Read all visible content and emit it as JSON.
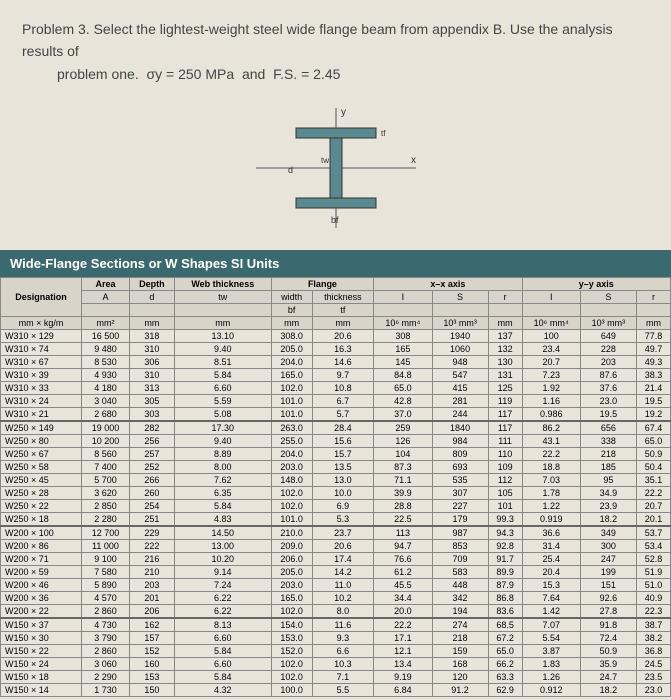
{
  "problem": {
    "title": "Problem 3.",
    "text1": "Select the lightest-weight steel wide flange beam from appendix B. Use the analysis results of",
    "text2": "problem one.",
    "sigma": "σy = 250 MPa",
    "and": "and",
    "fs": "F.S. = 2.45"
  },
  "diagram": {
    "y": "y",
    "x": "x",
    "tw": "tw",
    "d": "d",
    "tf": "tf",
    "bf": "bf"
  },
  "table_title": "Wide-Flange Sections or W Shapes   SI Units",
  "headers": {
    "flange": "Flange",
    "xx": "x–x axis",
    "yy": "y–y axis",
    "designation": "Designation",
    "area": "Area",
    "depth": "Depth",
    "web_thick": "Web thickness",
    "width": "width",
    "thickness": "thickness",
    "A": "A",
    "d": "d",
    "tw": "tw",
    "bf": "bf",
    "tf": "tf",
    "I": "I",
    "S": "S",
    "r": "r",
    "u_desig": "mm × kg/m",
    "u_mm2": "mm²",
    "u_mm": "mm",
    "u_I": "10⁶ mm⁴",
    "u_S": "10³ mm³",
    "u_r": "mm"
  },
  "rows": [
    {
      "d": "W310 × 129",
      "A": "16 500",
      "dep": "318",
      "tw": "13.10",
      "bf": "308.0",
      "tf": "20.6",
      "Ix": "308",
      "Sx": "1940",
      "rx": "137",
      "Iy": "100",
      "Sy": "649",
      "ry": "77.8"
    },
    {
      "d": "W310 × 74",
      "A": "9 480",
      "dep": "310",
      "tw": "9.40",
      "bf": "205.0",
      "tf": "16.3",
      "Ix": "165",
      "Sx": "1060",
      "rx": "132",
      "Iy": "23.4",
      "Sy": "228",
      "ry": "49.7"
    },
    {
      "d": "W310 × 67",
      "A": "8 530",
      "dep": "306",
      "tw": "8.51",
      "bf": "204.0",
      "tf": "14.6",
      "Ix": "145",
      "Sx": "948",
      "rx": "130",
      "Iy": "20.7",
      "Sy": "203",
      "ry": "49.3"
    },
    {
      "d": "W310 × 39",
      "A": "4 930",
      "dep": "310",
      "tw": "5.84",
      "bf": "165.0",
      "tf": "9.7",
      "Ix": "84.8",
      "Sx": "547",
      "rx": "131",
      "Iy": "7.23",
      "Sy": "87.6",
      "ry": "38.3"
    },
    {
      "d": "W310 × 33",
      "A": "4 180",
      "dep": "313",
      "tw": "6.60",
      "bf": "102.0",
      "tf": "10.8",
      "Ix": "65.0",
      "Sx": "415",
      "rx": "125",
      "Iy": "1.92",
      "Sy": "37.6",
      "ry": "21.4"
    },
    {
      "d": "W310 × 24",
      "A": "3 040",
      "dep": "305",
      "tw": "5.59",
      "bf": "101.0",
      "tf": "6.7",
      "Ix": "42.8",
      "Sx": "281",
      "rx": "119",
      "Iy": "1.16",
      "Sy": "23.0",
      "ry": "19.5"
    },
    {
      "d": "W310 × 21",
      "A": "2 680",
      "dep": "303",
      "tw": "5.08",
      "bf": "101.0",
      "tf": "5.7",
      "Ix": "37.0",
      "Sx": "244",
      "rx": "117",
      "Iy": "0.986",
      "Sy": "19.5",
      "ry": "19.2"
    },
    {
      "d": "W250 × 149",
      "A": "19 000",
      "dep": "282",
      "tw": "17.30",
      "bf": "263.0",
      "tf": "28.4",
      "Ix": "259",
      "Sx": "1840",
      "rx": "117",
      "Iy": "86.2",
      "Sy": "656",
      "ry": "67.4",
      "sep": true
    },
    {
      "d": "W250 × 80",
      "A": "10 200",
      "dep": "256",
      "tw": "9.40",
      "bf": "255.0",
      "tf": "15.6",
      "Ix": "126",
      "Sx": "984",
      "rx": "111",
      "Iy": "43.1",
      "Sy": "338",
      "ry": "65.0"
    },
    {
      "d": "W250 × 67",
      "A": "8 560",
      "dep": "257",
      "tw": "8.89",
      "bf": "204.0",
      "tf": "15.7",
      "Ix": "104",
      "Sx": "809",
      "rx": "110",
      "Iy": "22.2",
      "Sy": "218",
      "ry": "50.9"
    },
    {
      "d": "W250 × 58",
      "A": "7 400",
      "dep": "252",
      "tw": "8.00",
      "bf": "203.0",
      "tf": "13.5",
      "Ix": "87.3",
      "Sx": "693",
      "rx": "109",
      "Iy": "18.8",
      "Sy": "185",
      "ry": "50.4"
    },
    {
      "d": "W250 × 45",
      "A": "5 700",
      "dep": "266",
      "tw": "7.62",
      "bf": "148.0",
      "tf": "13.0",
      "Ix": "71.1",
      "Sx": "535",
      "rx": "112",
      "Iy": "7.03",
      "Sy": "95",
      "ry": "35.1"
    },
    {
      "d": "W250 × 28",
      "A": "3 620",
      "dep": "260",
      "tw": "6.35",
      "bf": "102.0",
      "tf": "10.0",
      "Ix": "39.9",
      "Sx": "307",
      "rx": "105",
      "Iy": "1.78",
      "Sy": "34.9",
      "ry": "22.2"
    },
    {
      "d": "W250 × 22",
      "A": "2 850",
      "dep": "254",
      "tw": "5.84",
      "bf": "102.0",
      "tf": "6.9",
      "Ix": "28.8",
      "Sx": "227",
      "rx": "101",
      "Iy": "1.22",
      "Sy": "23.9",
      "ry": "20.7"
    },
    {
      "d": "W250 × 18",
      "A": "2 280",
      "dep": "251",
      "tw": "4.83",
      "bf": "101.0",
      "tf": "5.3",
      "Ix": "22.5",
      "Sx": "179",
      "rx": "99.3",
      "Iy": "0.919",
      "Sy": "18.2",
      "ry": "20.1"
    },
    {
      "d": "W200 × 100",
      "A": "12 700",
      "dep": "229",
      "tw": "14.50",
      "bf": "210.0",
      "tf": "23.7",
      "Ix": "113",
      "Sx": "987",
      "rx": "94.3",
      "Iy": "36.6",
      "Sy": "349",
      "ry": "53.7",
      "sep": true
    },
    {
      "d": "W200 × 86",
      "A": "11 000",
      "dep": "222",
      "tw": "13.00",
      "bf": "209.0",
      "tf": "20.6",
      "Ix": "94.7",
      "Sx": "853",
      "rx": "92.8",
      "Iy": "31.4",
      "Sy": "300",
      "ry": "53.4"
    },
    {
      "d": "W200 × 71",
      "A": "9 100",
      "dep": "216",
      "tw": "10.20",
      "bf": "206.0",
      "tf": "17.4",
      "Ix": "76.6",
      "Sx": "709",
      "rx": "91.7",
      "Iy": "25.4",
      "Sy": "247",
      "ry": "52.8"
    },
    {
      "d": "W200 × 59",
      "A": "7 580",
      "dep": "210",
      "tw": "9.14",
      "bf": "205.0",
      "tf": "14.2",
      "Ix": "61.2",
      "Sx": "583",
      "rx": "89.9",
      "Iy": "20.4",
      "Sy": "199",
      "ry": "51.9"
    },
    {
      "d": "W200 × 46",
      "A": "5 890",
      "dep": "203",
      "tw": "7.24",
      "bf": "203.0",
      "tf": "11.0",
      "Ix": "45.5",
      "Sx": "448",
      "rx": "87.9",
      "Iy": "15.3",
      "Sy": "151",
      "ry": "51.0"
    },
    {
      "d": "W200 × 36",
      "A": "4 570",
      "dep": "201",
      "tw": "6.22",
      "bf": "165.0",
      "tf": "10.2",
      "Ix": "34.4",
      "Sx": "342",
      "rx": "86.8",
      "Iy": "7.64",
      "Sy": "92.6",
      "ry": "40.9"
    },
    {
      "d": "W200 × 22",
      "A": "2 860",
      "dep": "206",
      "tw": "6.22",
      "bf": "102.0",
      "tf": "8.0",
      "Ix": "20.0",
      "Sx": "194",
      "rx": "83.6",
      "Iy": "1.42",
      "Sy": "27.8",
      "ry": "22.3"
    },
    {
      "d": "W150 × 37",
      "A": "4 730",
      "dep": "162",
      "tw": "8.13",
      "bf": "154.0",
      "tf": "11.6",
      "Ix": "22.2",
      "Sx": "274",
      "rx": "68.5",
      "Iy": "7.07",
      "Sy": "91.8",
      "ry": "38.7",
      "sep": true
    },
    {
      "d": "W150 × 30",
      "A": "3 790",
      "dep": "157",
      "tw": "6.60",
      "bf": "153.0",
      "tf": "9.3",
      "Ix": "17.1",
      "Sx": "218",
      "rx": "67.2",
      "Iy": "5.54",
      "Sy": "72.4",
      "ry": "38.2"
    },
    {
      "d": "W150 × 22",
      "A": "2 860",
      "dep": "152",
      "tw": "5.84",
      "bf": "152.0",
      "tf": "6.6",
      "Ix": "12.1",
      "Sx": "159",
      "rx": "65.0",
      "Iy": "3.87",
      "Sy": "50.9",
      "ry": "36.8"
    },
    {
      "d": "W150 × 24",
      "A": "3 060",
      "dep": "160",
      "tw": "6.60",
      "bf": "102.0",
      "tf": "10.3",
      "Ix": "13.4",
      "Sx": "168",
      "rx": "66.2",
      "Iy": "1.83",
      "Sy": "35.9",
      "ry": "24.5"
    },
    {
      "d": "W150 × 18",
      "A": "2 290",
      "dep": "153",
      "tw": "5.84",
      "bf": "102.0",
      "tf": "7.1",
      "Ix": "9.19",
      "Sx": "120",
      "rx": "63.3",
      "Iy": "1.26",
      "Sy": "24.7",
      "ry": "23.5"
    },
    {
      "d": "W150 × 14",
      "A": "1 730",
      "dep": "150",
      "tw": "4.32",
      "bf": "100.0",
      "tf": "5.5",
      "Ix": "6.84",
      "Sx": "91.2",
      "rx": "62.9",
      "Iy": "0.912",
      "Sy": "18.2",
      "ry": "23.0"
    }
  ]
}
